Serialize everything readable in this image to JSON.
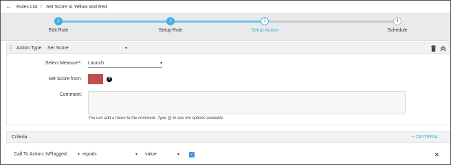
{
  "breadcrumb": {
    "back_icon": "back-arrow-icon",
    "root": "Rules List",
    "separator": "/",
    "current": "Set Score to Yellow and Red"
  },
  "stepper": {
    "steps": [
      {
        "number": "1",
        "label": "Edit Rule",
        "state": "done"
      },
      {
        "number": "2",
        "label": "Setup Rule",
        "state": "done"
      },
      {
        "number": "3",
        "label": "Setup Action",
        "state": "current"
      },
      {
        "number": "4",
        "label": "Schedule",
        "state": "todo"
      }
    ]
  },
  "action": {
    "number": "2",
    "type_label": "Action Type:",
    "type_value": "Set Score",
    "measure_label": "Select Measure*:",
    "measure_value": "Launch",
    "score_label": "Set Score from:",
    "score_color": "#c0504d",
    "comment_label": "Comment:",
    "comment_value": "",
    "comment_hint": "You can add a token to the comment. Type @ to see the options available."
  },
  "criteria": {
    "title": "Criteria",
    "add_label": "+ CRITERIA",
    "rows": [
      {
        "field": "Call To Action::IsFlagged",
        "operator": "equals",
        "value_type": "value",
        "checked": true
      }
    ]
  },
  "colors": {
    "accent": "#43aee0",
    "step_done_track": "#6cc1e3",
    "checkbox": "#3b93e6"
  }
}
